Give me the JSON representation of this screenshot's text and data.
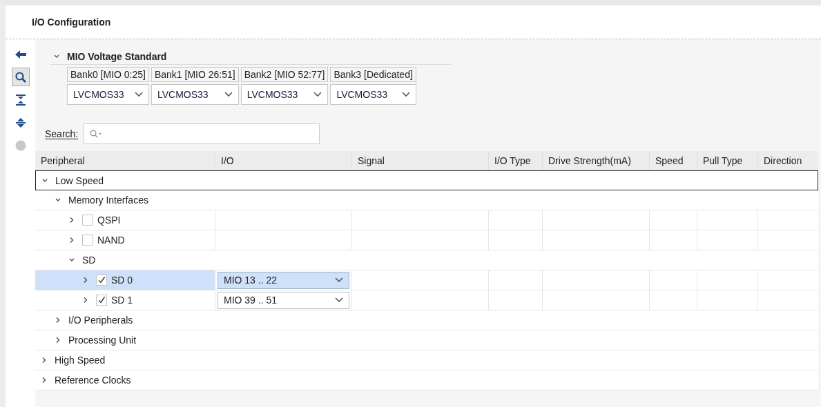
{
  "title": "I/O Configuration",
  "toolbar": [
    {
      "kind": "back",
      "selected": false
    },
    {
      "kind": "search",
      "selected": true
    },
    {
      "kind": "collapse",
      "selected": false
    },
    {
      "kind": "expand",
      "selected": false
    },
    {
      "kind": "status",
      "selected": false
    }
  ],
  "voltage": {
    "label": "MIO Voltage Standard",
    "expanded": true,
    "banks": [
      {
        "name": "Bank0 [MIO 0:25]",
        "value": "LVCMOS33"
      },
      {
        "name": "Bank1 [MIO 26:51]",
        "value": "LVCMOS33"
      },
      {
        "name": "Bank2 [MIO 52:77]",
        "value": "LVCMOS33"
      },
      {
        "name": "Bank3 [Dedicated]",
        "value": "LVCMOS33"
      }
    ]
  },
  "search": {
    "label": "Search:"
  },
  "table": {
    "columns": [
      "Peripheral",
      "I/O",
      "Signal",
      "I/O Type",
      "Drive Strength(mA)",
      "Speed",
      "Pull Type",
      "Direction"
    ],
    "rows": [
      {
        "label": "Low Speed",
        "expanded": true,
        "focused": true,
        "selected": false,
        "children": [
          {
            "label": "Memory Interfaces",
            "expanded": true,
            "focused": false,
            "selected": false,
            "children": [
              {
                "label": "QSPI",
                "kind": "checkbox",
                "checked": false,
                "expanded": false,
                "focused": false,
                "selected": false
              },
              {
                "label": "NAND",
                "kind": "checkbox",
                "checked": false,
                "expanded": false,
                "focused": false,
                "selected": false
              },
              {
                "label": "SD",
                "expanded": true,
                "focused": false,
                "selected": false,
                "children": [
                  {
                    "label": "SD 0",
                    "kind": "checkbox",
                    "checked": true,
                    "expanded": false,
                    "focused": false,
                    "selected": true,
                    "io": "MIO 13 .. 22"
                  },
                  {
                    "label": "SD 1",
                    "kind": "checkbox",
                    "checked": true,
                    "expanded": false,
                    "focused": false,
                    "selected": false,
                    "io": "MIO 39 .. 51"
                  }
                ]
              }
            ]
          },
          {
            "label": "I/O Peripherals",
            "expanded": false,
            "focused": false,
            "selected": false
          },
          {
            "label": "Processing Unit",
            "expanded": false,
            "focused": false,
            "selected": false
          }
        ]
      },
      {
        "label": "High Speed",
        "expanded": false,
        "focused": false,
        "selected": false
      },
      {
        "label": "Reference Clocks",
        "expanded": false,
        "focused": false,
        "selected": false
      }
    ]
  }
}
